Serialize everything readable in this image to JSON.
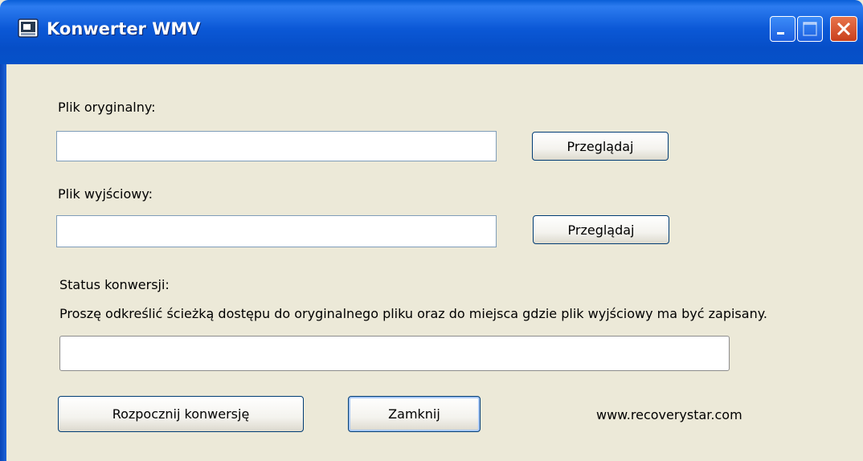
{
  "window": {
    "title": "Konwerter WMV"
  },
  "titlebar_buttons": {
    "minimize": "minimize-icon",
    "maximize": "maximize-icon",
    "close": "close-icon"
  },
  "source": {
    "label": "Plik oryginalny:",
    "value": "",
    "browse_label": "Przeglądaj"
  },
  "output": {
    "label": "Plik wyjściowy:",
    "value": "",
    "browse_label": "Przeglądaj"
  },
  "status": {
    "label": "Status konwersji:",
    "message": "Proszę odkreślić ścieżką dostępu do oryginalnego pliku oraz do miejsca gdzie plik wyjściowy ma być zapisany.",
    "progress": 0
  },
  "actions": {
    "start_label": "Rozpocznij konwersję",
    "close_label": "Zamknij"
  },
  "footer": {
    "website": "www.recoverystar.com"
  },
  "colors": {
    "titlebar": "#0b58d6",
    "window_bg": "#ece9d8",
    "close_button": "#c9401c"
  }
}
